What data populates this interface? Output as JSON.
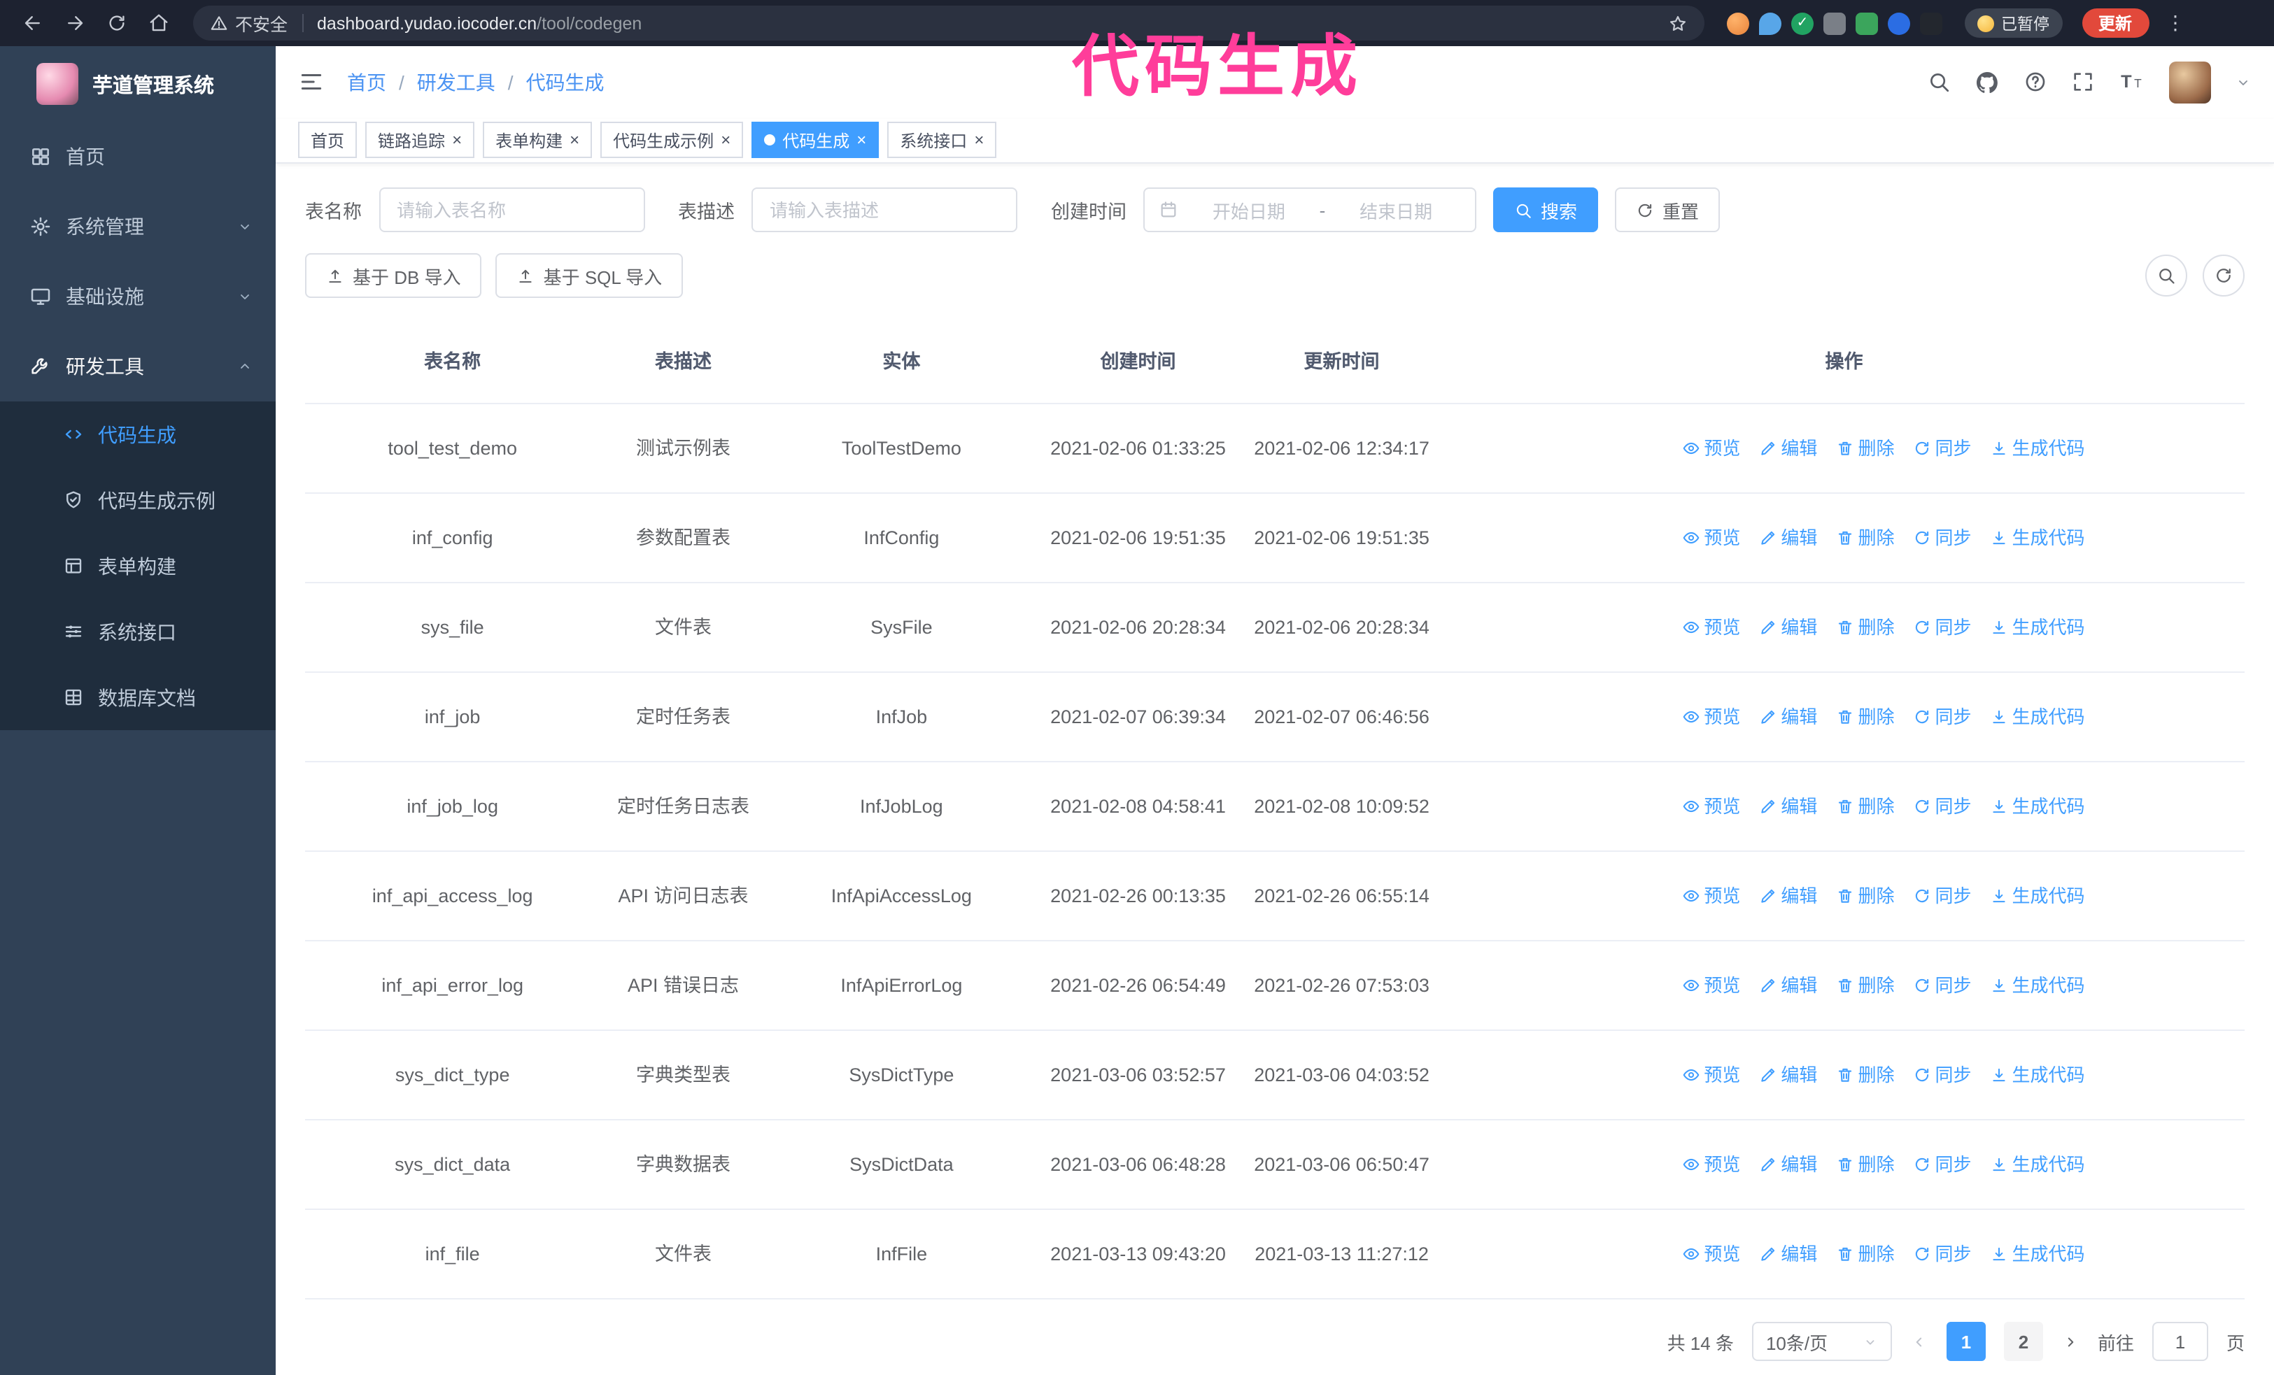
{
  "browser": {
    "security_label": "不安全",
    "url_domain": "dashboard.yudao.iocoder.cn",
    "url_path": "/tool/codegen",
    "paused_badge": "已暂停",
    "update_button": "更新"
  },
  "annotation": {
    "text": "代码生成",
    "color": "#ff3d9a"
  },
  "sidebar": {
    "logo_title": "芋道管理系统",
    "items": [
      {
        "label": "首页"
      },
      {
        "label": "系统管理"
      },
      {
        "label": "基础设施"
      },
      {
        "label": "研发工具"
      }
    ],
    "submenu": [
      {
        "label": "代码生成"
      },
      {
        "label": "代码生成示例"
      },
      {
        "label": "表单构建"
      },
      {
        "label": "系统接口"
      },
      {
        "label": "数据库文档"
      }
    ]
  },
  "header": {
    "breadcrumb": [
      "首页",
      "研发工具",
      "代码生成"
    ]
  },
  "tabs": [
    {
      "label": "首页"
    },
    {
      "label": "链路追踪"
    },
    {
      "label": "表单构建"
    },
    {
      "label": "代码生成示例"
    },
    {
      "label": "代码生成"
    },
    {
      "label": "系统接口"
    }
  ],
  "filters": {
    "table_name_label": "表名称",
    "table_name_placeholder": "请输入表名称",
    "table_desc_label": "表描述",
    "table_desc_placeholder": "请输入表描述",
    "create_time_label": "创建时间",
    "start_placeholder": "开始日期",
    "range_separator": "-",
    "end_placeholder": "结束日期",
    "search_button": "搜索",
    "reset_button": "重置"
  },
  "toolbar": {
    "import_db": "基于 DB 导入",
    "import_sql": "基于 SQL 导入"
  },
  "table": {
    "columns": [
      "表名称",
      "表描述",
      "实体",
      "创建时间",
      "更新时间",
      "操作"
    ],
    "actions": [
      "预览",
      "编辑",
      "删除",
      "同步",
      "生成代码"
    ],
    "rows": [
      {
        "name": "tool_test_demo",
        "desc": "测试示例表",
        "entity": "ToolTestDemo",
        "created": "2021-02-06 01:33:25",
        "updated": "2021-02-06 12:34:17"
      },
      {
        "name": "inf_config",
        "desc": "参数配置表",
        "entity": "InfConfig",
        "created": "2021-02-06 19:51:35",
        "updated": "2021-02-06 19:51:35"
      },
      {
        "name": "sys_file",
        "desc": "文件表",
        "entity": "SysFile",
        "created": "2021-02-06 20:28:34",
        "updated": "2021-02-06 20:28:34"
      },
      {
        "name": "inf_job",
        "desc": "定时任务表",
        "entity": "InfJob",
        "created": "2021-02-07 06:39:34",
        "updated": "2021-02-07 06:46:56"
      },
      {
        "name": "inf_job_log",
        "desc": "定时任务日志表",
        "entity": "InfJobLog",
        "created": "2021-02-08 04:58:41",
        "updated": "2021-02-08 10:09:52"
      },
      {
        "name": "inf_api_access_log",
        "desc": "API 访问日志表",
        "entity": "InfApiAccessLog",
        "created": "2021-02-26 00:13:35",
        "updated": "2021-02-26 06:55:14"
      },
      {
        "name": "inf_api_error_log",
        "desc": "API 错误日志",
        "entity": "InfApiErrorLog",
        "created": "2021-02-26 06:54:49",
        "updated": "2021-02-26 07:53:03"
      },
      {
        "name": "sys_dict_type",
        "desc": "字典类型表",
        "entity": "SysDictType",
        "created": "2021-03-06 03:52:57",
        "updated": "2021-03-06 04:03:52"
      },
      {
        "name": "sys_dict_data",
        "desc": "字典数据表",
        "entity": "SysDictData",
        "created": "2021-03-06 06:48:28",
        "updated": "2021-03-06 06:50:47"
      },
      {
        "name": "inf_file",
        "desc": "文件表",
        "entity": "InfFile",
        "created": "2021-03-13 09:43:20",
        "updated": "2021-03-13 11:27:12"
      }
    ]
  },
  "pagination": {
    "total": "共 14 条",
    "page_size": "10条/页",
    "pages": [
      "1",
      "2"
    ],
    "goto_label": "前往",
    "goto_value": "1",
    "goto_suffix": "页"
  }
}
